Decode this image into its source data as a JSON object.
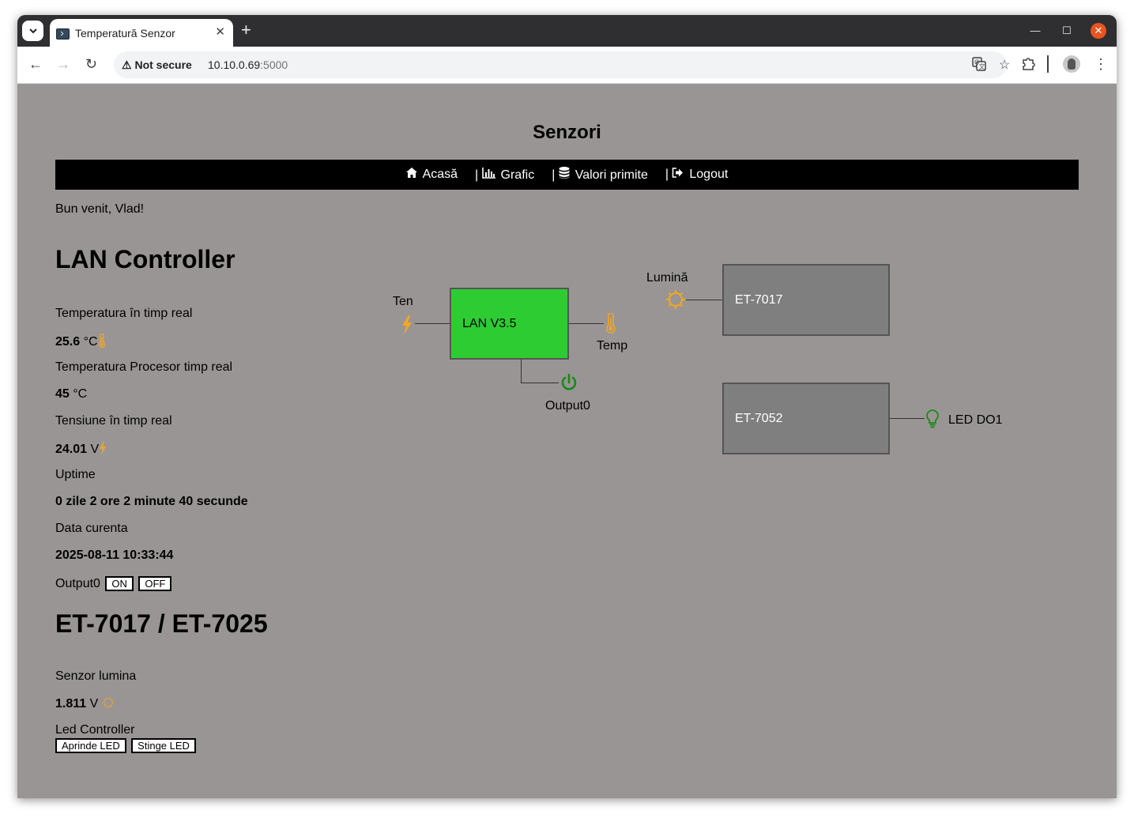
{
  "browser": {
    "tab_title": "Temperatură Senzor",
    "security_label": "Not secure",
    "url_host": "10.10.0.69",
    "url_port": ":5000"
  },
  "page": {
    "site_title": "Senzori",
    "nav": [
      {
        "icon": "home-icon",
        "label": "Acasă"
      },
      {
        "icon": "bar-chart-icon",
        "label": "Grafic",
        "separator": "|"
      },
      {
        "icon": "database-icon",
        "label": "Valori primite",
        "separator": "|"
      },
      {
        "icon": "logout-icon",
        "label": "Logout",
        "separator": "|"
      }
    ],
    "welcome": "Bun venit, Vlad!",
    "lan": {
      "heading": "LAN Controller",
      "temp_label": "Temperatura în timp real",
      "temp_value": "25.6",
      "temp_unit": "°C",
      "cpu_label": "Temperatura Procesor timp real",
      "cpu_value": "45",
      "cpu_unit": "°C",
      "voltage_label": "Tensiune în timp real",
      "voltage_value": "24.01",
      "voltage_unit": "V",
      "uptime_label": "Uptime",
      "uptime_value": "0 zile 2 ore 2 minute 40 secunde",
      "date_label": "Data curenta",
      "date_value": "2025-08-11 10:33:44",
      "output_label": "Output0",
      "on_label": "ON",
      "off_label": "OFF"
    },
    "et": {
      "heading": "ET-7017 / ET-7025",
      "light_label": "Senzor lumina",
      "light_value": "1.811",
      "light_unit": "V",
      "led_label": "Led Controller",
      "led_on_label": "Aprinde LED",
      "led_off_label": "Stinge LED"
    },
    "diagram": {
      "lan_box": "LAN V3.5",
      "ten_label": "Ten",
      "temp_label": "Temp",
      "output_label": "Output0",
      "et7017_box": "ET-7017",
      "light_label": "Lumină",
      "et7052_box": "ET-7052",
      "led_label": "LED DO1",
      "colors": {
        "lan_box": "#2ecc33",
        "et_box": "#7f7f7f",
        "icon_orange": "#f5a623",
        "icon_green": "#1a8a1a"
      }
    }
  }
}
